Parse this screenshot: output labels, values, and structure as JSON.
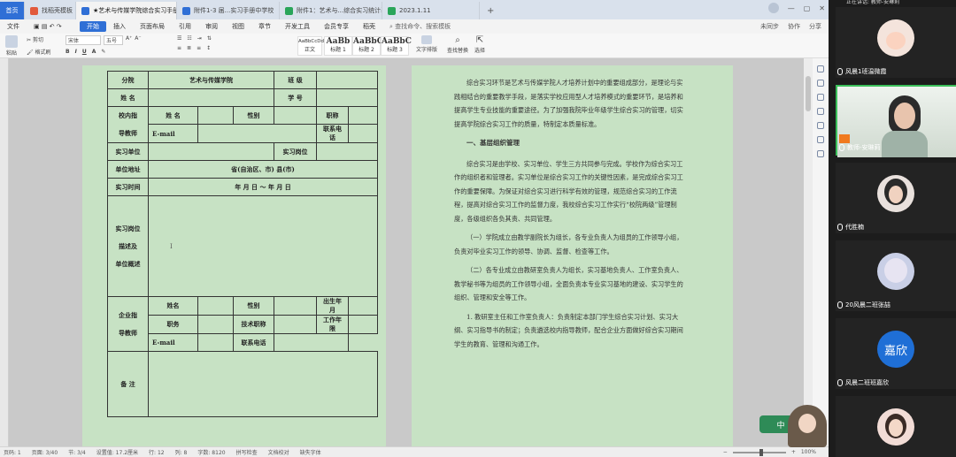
{
  "tabs": [
    {
      "label": "首页",
      "kind": "home"
    },
    {
      "label": "找稻壳模板",
      "color": "#e25a3c"
    },
    {
      "label": "★艺术与传媒学院综合实习手册",
      "color": "#2f6fd6",
      "active": true
    },
    {
      "label": "附件1-3 届...实习手册中学校",
      "color": "#2f6fd6"
    },
    {
      "label": "附件1：艺术与...综合实习统计表",
      "color": "#2aa55a"
    },
    {
      "label": "2023.1.11",
      "color": "#2aa55a"
    }
  ],
  "tab_plus": "+",
  "menu": {
    "items": [
      "文件",
      "开始",
      "插入",
      "页面布局",
      "引用",
      "审阅",
      "视图",
      "章节",
      "开发工具",
      "会员专享",
      "稻壳"
    ],
    "active": "开始",
    "search": "查找命令、搜索模板",
    "right": [
      "未同步",
      "协作",
      "分享"
    ]
  },
  "ribbon": {
    "paste": "粘贴",
    "cut": "剪切",
    "format_painter": "格式刷",
    "font_name": "宋体",
    "font_size": "五号",
    "styles": [
      {
        "sample": "AaBbCcDd",
        "name": "正文"
      },
      {
        "sample": "AaBb",
        "name": "标题 1"
      },
      {
        "sample": "AaBbC",
        "name": "标题 2"
      },
      {
        "sample": "AaBbC",
        "name": "标题 3"
      }
    ],
    "text_layout": "文字排版",
    "find_replace": "查找替换",
    "select": "选择"
  },
  "form": {
    "department_label": "分院",
    "department_value": "艺术与传媒学院",
    "class_label": "班 级",
    "name_label": "姓 名",
    "student_id_label": "学 号",
    "school_guide_label_1": "校内指",
    "school_guide_label_2": "导教师",
    "guide_name_label": "姓 名",
    "gender_label": "性别",
    "title_label": "职称",
    "email_label": "E-mail",
    "phone_label": "联系电话",
    "unit_label": "实习单位",
    "position_label": "实习岗位",
    "address_label": "单位地址",
    "address_value": "省(自治区、市)        县(市)",
    "time_label": "实习时间",
    "time_value": "年  月  日   ～   年  月  日",
    "desc_label_1": "实习岗位",
    "desc_label_2": "描述及",
    "desc_label_3": "单位概述",
    "company_guide_label_1": "企业指",
    "company_guide_label_2": "导教师",
    "cg_name_label": "姓名",
    "cg_gender_label": "性别",
    "cg_birth_label": "出生年月",
    "cg_post_label": "职务",
    "cg_tech_label": "技术职称",
    "cg_years_label": "工作年限",
    "cg_email_label": "E-mail",
    "cg_phone_label": "联系电话",
    "remarks_label": "备 注"
  },
  "page2": {
    "intro": "综合实习环节是艺术与传媒学院人才培养计划中的重要组成部分，是理论与实践相结合的重要教学手段，是落实学校应用型人才培养模式的重要环节，是培养和提高学生专业技能的重要途径。为了加强我院毕业年级学生综合实习的管理，切实提高学院综合实习工作的质量，特制定本质量标准。",
    "heading1": "一、基层组织管理",
    "para1": "综合实习是由学校、实习单位、学生三方共同参与完成。学校作为综合实习工作的组织者和管理者。实习单位是综合实习工作的关键性因素，是完成综合实习工作的重要保障。为保证对综合实习进行科学有效的管理，规范综合实习的工作流程，提高对综合实习工作的监督力度，我校综合实习工作实行“校院两级”管理制度，各级组织各负其责、共同管理。",
    "para2": "（一）学院成立由教学副院长为组长，各专业负责人为组员的工作领导小组，负责对毕业实习工作的领导、协调、监督、检查等工作。",
    "para3": "（二）各专业成立由教研室负责人为组长，实习基地负责人、工作室负责人、教学秘书等为组员的工作领导小组，全面负责本专业实习基地的建设、实习学生的组织、管理和安全等工作。",
    "para4": "1. 教研室主任和工作室负责人：负责制定本部门学生综合实习计划、实习大纲、实习指导书的制定；负责遴选校内指导教师，配合企业方面做好综合实习期间学生的教育、管理和沟通工作。"
  },
  "status": {
    "page": "页码: 1",
    "pages": "页面: 3/40",
    "section": "节: 3/4",
    "setting": "设置值: 17.2厘米",
    "row": "行: 12",
    "col": "列: 8",
    "words": "字数: 8120",
    "spell": "拼写检查",
    "proof": "文档校对",
    "font_missing": "缺失字体",
    "zoom": "100%"
  },
  "float_widget": {
    "label": "中"
  },
  "video_panel": {
    "top_label": "正在讲话: 教师-安琳莉",
    "participants": [
      {
        "name": "风晨1班温微霞",
        "avatar": "cartoon"
      },
      {
        "name": "教师-安琳莉",
        "avatar": "camera"
      },
      {
        "name": "代胜楠",
        "avatar": "photo"
      },
      {
        "name": "20风晨二班张喆",
        "avatar": "cartoon"
      },
      {
        "name": "风晨二班班嘉欣",
        "avatar": "text",
        "avatar_text": "嘉欣"
      },
      {
        "name": "",
        "avatar": "photo"
      }
    ]
  }
}
